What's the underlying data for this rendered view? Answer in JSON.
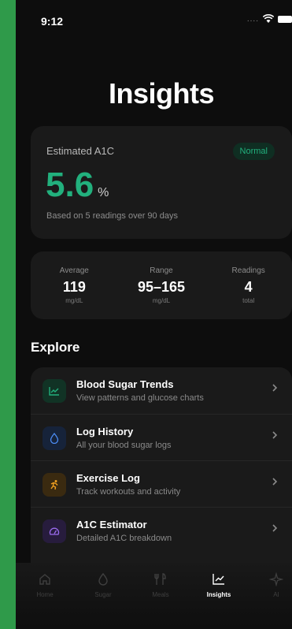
{
  "status_bar": {
    "time": "9:12",
    "signal": "...."
  },
  "header": {
    "title": "Insights"
  },
  "a1c_card": {
    "label": "Estimated A1C",
    "badge": "Normal",
    "value": "5.6",
    "unit": "%",
    "note": "Based on 5 readings over 90 days"
  },
  "stats": [
    {
      "label": "Average",
      "value": "119",
      "unit": "mg/dL"
    },
    {
      "label": "Range",
      "value": "95–165",
      "unit": "mg/dL"
    },
    {
      "label": "Readings",
      "value": "4",
      "unit": "total"
    }
  ],
  "explore": {
    "title": "Explore",
    "items": [
      {
        "title": "Blood Sugar Trends",
        "subtitle": "View patterns and glucose charts",
        "icon": "trend-chart-icon",
        "color": "#22b07d",
        "bg": "#113325"
      },
      {
        "title": "Log History",
        "subtitle": "All your blood sugar logs",
        "icon": "drop-icon",
        "color": "#4c8df5",
        "bg": "#16233a"
      },
      {
        "title": "Exercise Log",
        "subtitle": "Track workouts and activity",
        "icon": "running-icon",
        "color": "#f0a020",
        "bg": "#3a2a10"
      },
      {
        "title": "A1C Estimator",
        "subtitle": "Detailed A1C breakdown",
        "icon": "gauge-icon",
        "color": "#9b6cf0",
        "bg": "#271c3d"
      }
    ]
  },
  "tab_bar": {
    "tabs": [
      {
        "label": "Home",
        "icon": "home-icon"
      },
      {
        "label": "Sugar",
        "icon": "drop-icon"
      },
      {
        "label": "Meals",
        "icon": "utensils-icon"
      },
      {
        "label": "Insights",
        "icon": "chart-icon",
        "active": true
      },
      {
        "label": "AI",
        "icon": "sparkle-icon"
      }
    ]
  },
  "colors": {
    "accent": "#22b07d",
    "background": "#0d0d0d",
    "card": "#1a1a1a",
    "frame": "#2f9a4a"
  }
}
